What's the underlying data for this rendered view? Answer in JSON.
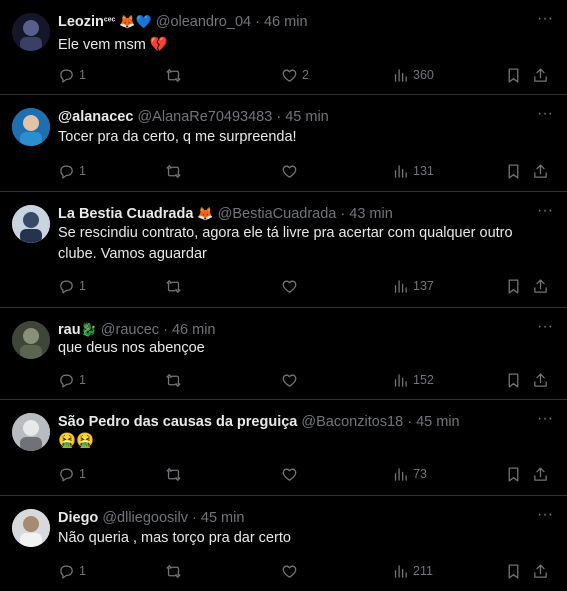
{
  "tweets": [
    {
      "name": "Leozin",
      "name_suffix": "ᶜᵉᶜ",
      "emojis": "🦊💙",
      "handle": "@oleandro_04",
      "time": "46 min",
      "text": "Ele vem msm 💔",
      "replies": "1",
      "retweets": "",
      "likes": "2",
      "views": "360",
      "avatar_color": "#1b1b2e"
    },
    {
      "name": "@alanacec",
      "name_suffix": "",
      "emojis": "",
      "handle": "@AlanaRe70493483",
      "time": "45 min",
      "text": "Tocer pra da certo, q me surpreenda!",
      "replies": "1",
      "retweets": "",
      "likes": "",
      "views": "131",
      "avatar_color": "#2a8fd0"
    },
    {
      "name": "La Bestia Cuadrada",
      "name_suffix": "",
      "emojis": "🦊",
      "handle": "@BestiaCuadrada",
      "time": "43 min",
      "text": "Se rescindiu contrato, agora ele tá livre pra acertar com qualquer outro clube. Vamos aguardar",
      "replies": "1",
      "retweets": "",
      "likes": "",
      "views": "137",
      "avatar_color": "#c9d4e0"
    },
    {
      "name": "rau",
      "name_suffix": "",
      "emojis": "🐉",
      "handle": "@raucec",
      "time": "46 min",
      "text": "que deus nos abençoe",
      "replies": "1",
      "retweets": "",
      "likes": "",
      "views": "152",
      "avatar_color": "#4d5a45"
    },
    {
      "name": "São Pedro das causas da preguiça",
      "name_suffix": "",
      "emojis": "",
      "handle": "@Baconzitos18",
      "time": "45 min",
      "text": "🤮🤮",
      "replies": "1",
      "retweets": "",
      "likes": "",
      "views": "73",
      "avatar_color": "#b8bcc0"
    },
    {
      "name": "Diego",
      "name_suffix": "",
      "emojis": "",
      "handle": "@dlliegoosilv",
      "time": "45 min",
      "text": "Não queria , mas torço pra dar certo",
      "replies": "1",
      "retweets": "",
      "likes": "",
      "views": "211",
      "avatar_color": "#d7d9dc"
    }
  ],
  "icons": {
    "more": "more-icon",
    "reply": "reply-icon",
    "retweet": "retweet-icon",
    "like": "heart-icon",
    "views": "views-icon",
    "bookmark": "bookmark-icon",
    "share": "share-icon"
  },
  "colors": {
    "background": "#000000",
    "text": "#e7e9ea",
    "muted": "#71767b",
    "divider": "#2f3336"
  }
}
